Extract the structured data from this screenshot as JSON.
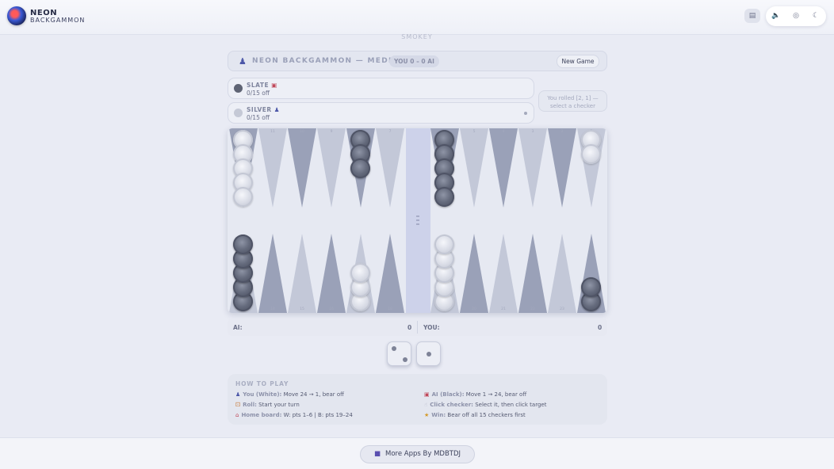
{
  "header": {
    "brand_line1": "NEON",
    "brand_line2": "BACKGAMMON",
    "theme_label": "SMOKEY"
  },
  "game": {
    "title": "NEON BACKGAMMON — MEDIUM",
    "score": "YOU 0 – 0 AI",
    "new_game_label": "New Game",
    "status": "You rolled [2, 1] — select a checker"
  },
  "players": [
    {
      "name": "SLATE",
      "icon": "robot-icon",
      "off": "0/15 off",
      "checker_color": "#5f6474"
    },
    {
      "name": "SILVER",
      "icon": "person-icon",
      "off": "0/15 off",
      "checker_color": "#c5c9d6"
    }
  ],
  "board": {
    "top_numbers": [
      "12",
      "11",
      "10",
      "9",
      "8",
      "7",
      "6",
      "5",
      "4",
      "3",
      "2",
      "1"
    ],
    "bottom_numbers": [
      "13",
      "14",
      "15",
      "16",
      "17",
      "18",
      "19",
      "20",
      "21",
      "22",
      "23",
      "24"
    ],
    "top_checkers": [
      {
        "point": 0,
        "color": "light",
        "count": 5
      },
      {
        "point": 4,
        "color": "dark",
        "count": 3
      },
      {
        "point": 6,
        "color": "dark",
        "count": 5
      },
      {
        "point": 11,
        "color": "light",
        "count": 2
      }
    ],
    "bottom_checkers": [
      {
        "point": 0,
        "color": "dark",
        "count": 5
      },
      {
        "point": 4,
        "color": "light",
        "count": 3
      },
      {
        "point": 6,
        "color": "light",
        "count": 5
      },
      {
        "point": 11,
        "color": "dark",
        "count": 2
      }
    ]
  },
  "bear_off": {
    "ai_label": "AI:",
    "ai_value": "0",
    "you_label": "YOU:",
    "you_value": "0"
  },
  "dice": [
    2,
    1
  ],
  "how_to_play": {
    "heading": "HOW TO PLAY",
    "left": [
      {
        "icon": "person-icon",
        "key": "You (White):",
        "text": "Move 24 → 1, bear off"
      },
      {
        "icon": "dice-icon",
        "key": "Roll:",
        "text": "Start your turn"
      },
      {
        "icon": "house-icon",
        "key": "Home board:",
        "text": "W: pts 1–6 | B: pts 19–24"
      }
    ],
    "right": [
      {
        "icon": "robot-icon",
        "key": "AI (Black):",
        "text": "Move 1 → 24, bear off"
      },
      {
        "icon": "pointer-icon",
        "key": "Click checker:",
        "text": "Select it, then click target"
      },
      {
        "icon": "trophy-icon",
        "key": "Win:",
        "text": "Bear off all 15 checkers first"
      }
    ]
  },
  "footer": {
    "more_apps_label": "More Apps By MDBTDJ"
  }
}
